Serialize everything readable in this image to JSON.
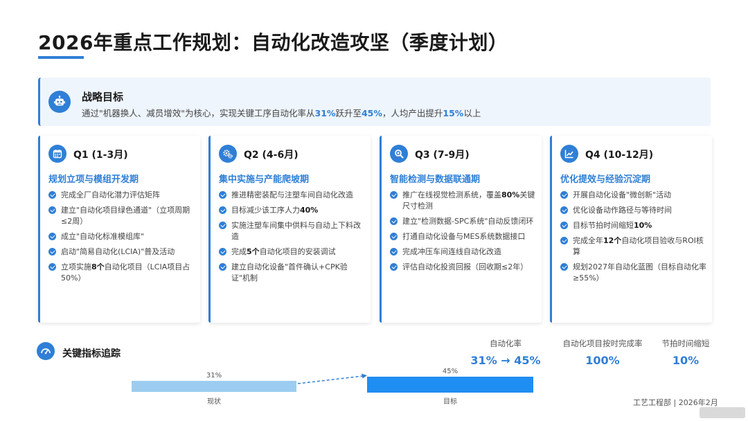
{
  "title": "2026年重点工作规划：自动化改造攻坚（季度计划）",
  "strategy": {
    "heading": "战略目标",
    "desc_pre": "通过\"机器换人、减员增效\"为核心，实现关键工序自动化率从",
    "desc_v1": "31%",
    "desc_mid": "跃升至",
    "desc_v2": "45%",
    "desc_mid2": "，人均产出提升",
    "desc_v3": "15%",
    "desc_post": "以上"
  },
  "quarters": [
    {
      "label": "Q1 (1-3月)",
      "icon": "calendar-icon",
      "subtitle": "规划立项与模组开发期",
      "items": [
        {
          "text": "完成全厂自动化潜力评估矩阵"
        },
        {
          "text": "建立\"自动化项目绿色通道\"（立项周期≤2周）"
        },
        {
          "text": "成立\"自动化标准模组库\""
        },
        {
          "text": "启动\"简易自动化(LCIA)\"普及活动"
        },
        {
          "pre": "立项实施",
          "bold": "8个",
          "post": "自动化项目（LCIA项目占50%）"
        }
      ]
    },
    {
      "label": "Q2 (4-6月)",
      "icon": "gears-icon",
      "subtitle": "集中实施与产能爬坡期",
      "items": [
        {
          "text": "推进精密装配与注塑车间自动化改造"
        },
        {
          "pre": "目标减少该工序人力",
          "bold": "40%",
          "post": ""
        },
        {
          "text": "实施注塑车间集中供料与自动上下料改造"
        },
        {
          "pre": "完成",
          "bold": "5个",
          "post": "自动化项目的安装调试"
        },
        {
          "text": "建立自动化设备\"首件确认+CPK验证\"机制"
        }
      ]
    },
    {
      "label": "Q3 (7-9月)",
      "icon": "magnifier-icon",
      "subtitle": "智能检测与数据联通期",
      "items": [
        {
          "pre": "推广在线视觉检测系统，覆盖",
          "bold": "80%",
          "post": "关键尺寸检测"
        },
        {
          "text": "建立\"检测数据-SPC系统\"自动反馈闭环"
        },
        {
          "text": "打通自动化设备与MES系统数据接口"
        },
        {
          "text": "完成冲压车间连线自动化改造"
        },
        {
          "text": "评估自动化投资回报（回收期≤2年）"
        }
      ]
    },
    {
      "label": "Q4 (10-12月)",
      "icon": "trend-chart-icon",
      "subtitle": "优化提效与经验沉淀期",
      "items": [
        {
          "text": "开展自动化设备\"微创新\"活动"
        },
        {
          "text": "优化设备动作路径与等待时间"
        },
        {
          "pre": "目标节拍时间缩短",
          "bold": "10%",
          "post": ""
        },
        {
          "pre": "完成全年",
          "bold": "12个",
          "post": "自动化项目验收与ROI核算"
        },
        {
          "text": "规划2027年自动化蓝图（目标自动化率≥55%）"
        }
      ]
    }
  ],
  "kpi": {
    "heading": "关键指标追踪",
    "metrics": [
      {
        "label": "自动化率",
        "value": "31% → 45%"
      },
      {
        "label": "自动化项目按时完成率",
        "value": "100%"
      },
      {
        "label": "节拍时间缩短",
        "value": "10%"
      }
    ],
    "bar_current": {
      "value": "31%",
      "label": "现状"
    },
    "bar_target": {
      "value": "45%",
      "label": "目标"
    }
  },
  "footer": "工艺工程部 | 2026年2月",
  "colors": {
    "accent": "#2f7fd6",
    "bar_light": "#9ccdf0",
    "bar_dark": "#1f8ef2"
  }
}
